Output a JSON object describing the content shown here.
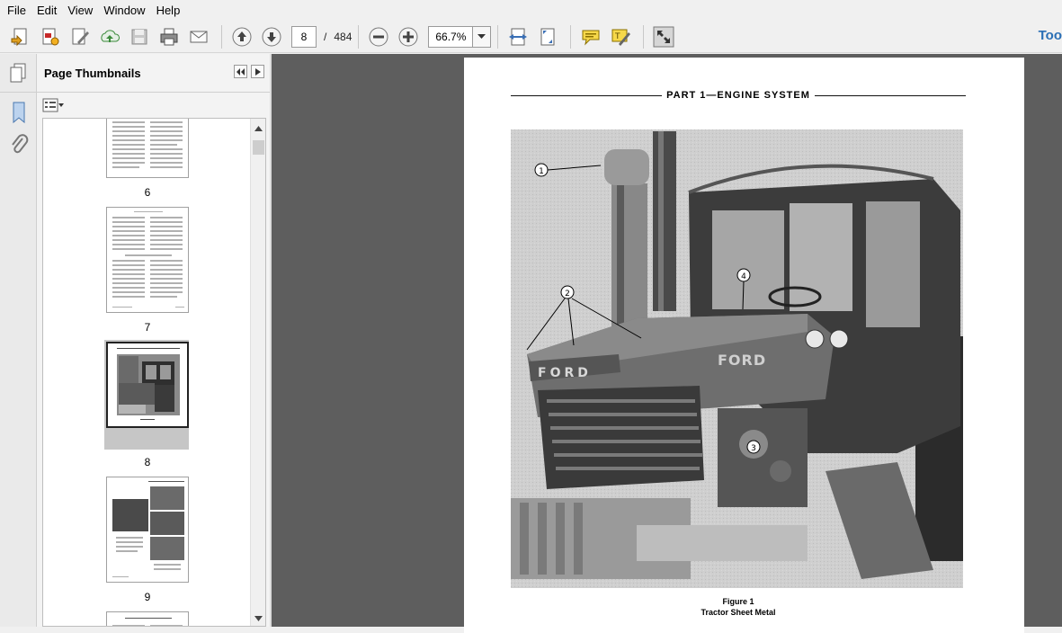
{
  "menu": [
    "File",
    "Edit",
    "View",
    "Window",
    "Help"
  ],
  "toolbar": {
    "current_page": "8",
    "page_separator": "/",
    "page_total": "484",
    "zoom": "66.7%",
    "tools_label": "Too"
  },
  "panel": {
    "title": "Page Thumbnails"
  },
  "thumbnails": [
    {
      "label": "6"
    },
    {
      "label": "7"
    },
    {
      "label": "8"
    },
    {
      "label": "9"
    }
  ],
  "document": {
    "heading": "PART 1—ENGINE SYSTEM",
    "figure_label": "Figure 1",
    "figure_caption": "Tractor Sheet Metal",
    "callouts": [
      "1",
      "2",
      "3",
      "4"
    ]
  },
  "colors": {
    "doc_background": "#5e5e5e",
    "accent": "#2a6fb5"
  }
}
